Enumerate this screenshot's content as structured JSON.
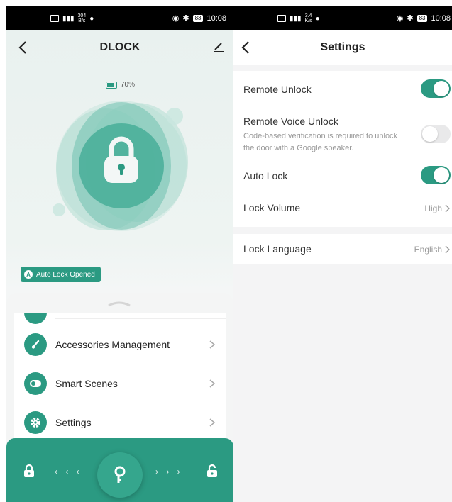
{
  "left": {
    "status": {
      "speed_value": "304",
      "speed_unit": "B/s",
      "battery": "83",
      "time": "10:08"
    },
    "nav": {
      "title": "DLOCK"
    },
    "battery": {
      "percent_text": "70%",
      "level": 0.7
    },
    "badge": {
      "icon": "A",
      "label": "Auto Lock Opened"
    },
    "menu": [
      {
        "label": "Accessories Management",
        "icon": "brush-icon"
      },
      {
        "label": "Smart Scenes",
        "icon": "toggle-icon"
      },
      {
        "label": "Settings",
        "icon": "gear-icon"
      }
    ],
    "bottom": {
      "left_arrows": "‹ ‹ ‹",
      "right_arrows": "› › ›",
      "colors": {
        "accent": "#2b9a82"
      }
    }
  },
  "right": {
    "status": {
      "speed_value": "3.4",
      "speed_unit": "K/s",
      "battery": "83",
      "time": "10:08"
    },
    "nav": {
      "title": "Settings"
    },
    "settings": {
      "remote_unlock": {
        "label": "Remote Unlock",
        "on": true
      },
      "remote_voice_unlock": {
        "label": "Remote Voice Unlock",
        "description": "Code-based verification is required to unlock the door with a Google speaker.",
        "on": false
      },
      "auto_lock": {
        "label": "Auto Lock",
        "on": true
      },
      "lock_volume": {
        "label": "Lock Volume",
        "value": "High"
      },
      "lock_language": {
        "label": "Lock Language",
        "value": "English"
      }
    }
  }
}
